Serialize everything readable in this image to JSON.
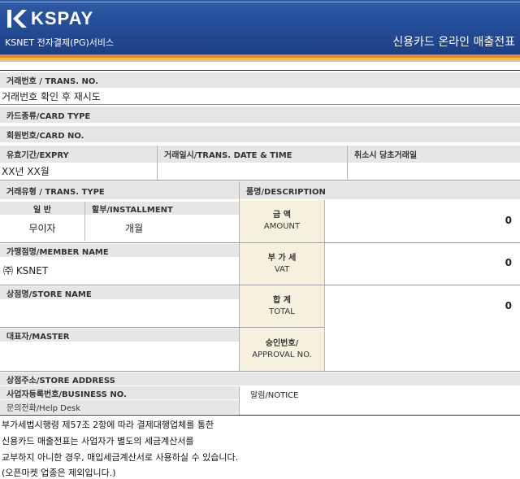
{
  "header": {
    "logo_text": "KSPAY",
    "subtitle": "KSNET 전자결제(PG)서비스",
    "title": "신용카드 온라인 매출전표",
    "colors": {
      "header_blue": "#2a52a0",
      "accent_orange": "#e98b22",
      "accent_yellow": "#f3c13a",
      "label_gray": "#e6e6e6",
      "amount_beige": "#f5f1dc"
    }
  },
  "receipt": {
    "trans_no_label": "거래번호 / TRANS. NO.",
    "trans_no_value": "거래번호 확인 후 재시도",
    "card_type_label": "카드종류/CARD TYPE",
    "card_no_label": "회원번호/CARD NO.",
    "expiry_label": "유효기간/EXPRY",
    "expiry_value": "XX년  XX월",
    "trans_date_label": "거래일시/TRANS. DATE & TIME",
    "cancel_label": "취소시 당초거래일",
    "trans_type_label": "거래유형 / TRANS. TYPE",
    "description_label": "품명/DESCRIPTION",
    "lump_sum_label": "일    반",
    "installment_label": "할부/INSTALLMENT",
    "lump_sum_value": "무이자",
    "installment_value": "개월",
    "amount_label_ko": "금    액",
    "amount_label_en": "AMOUNT",
    "amount_value": "0",
    "member_name_label": "가맹점명/MEMBER NAME",
    "member_name_value": "㈜ KSNET",
    "vat_label_ko": "부 가 세",
    "vat_label_en": "VAT",
    "vat_value": "0",
    "store_name_label": "상점명/STORE NAME",
    "total_label_ko": "합    계",
    "total_label_en": "TOTAL",
    "total_value": "0",
    "master_label": "대표자/MASTER",
    "approval_label_ko": "승인번호/",
    "approval_label_en": "APPROVAL NO.",
    "store_address_label": "상점주소/STORE ADDRESS",
    "business_no_label": "사업자등록번호/BUSINESS NO.",
    "notice_label": "알림/NOTICE",
    "help_desk_label": "문의전화/Help Desk"
  },
  "footer": {
    "lines": [
      "부가세법시행령 제57조 2항에 따라 결제대행업체를 통한",
      "신용카드 매출전표는 사업자가 별도의 세금계산서를",
      "교부하지 아니한 경우, 매입세금계산서로 사용하실 수 있습니다.",
      "(오픈마켓 업종은 제외입니다.)"
    ]
  }
}
